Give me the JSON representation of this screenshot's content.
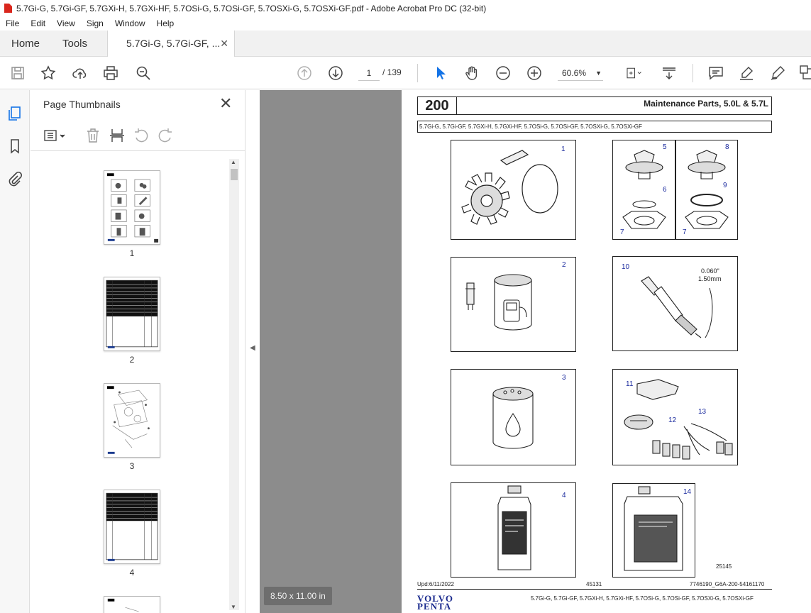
{
  "window": {
    "title": "5.7Gi-G, 5.7Gi-GF, 5.7GXi-H, 5.7GXi-HF, 5.7OSi-G, 5.7OSi-GF, 5.7OSXi-G, 5.7OSXi-GF.pdf - Adobe Acrobat Pro DC (32-bit)"
  },
  "menu": [
    "File",
    "Edit",
    "View",
    "Sign",
    "Window",
    "Help"
  ],
  "tabs": {
    "home": "Home",
    "tools": "Tools",
    "doc": "5.7Gi-G, 5.7Gi-GF, ..."
  },
  "toolbar": {
    "page_current": "1",
    "page_total": "/ 139",
    "zoom": "60.6%"
  },
  "panel": {
    "title": "Page Thumbnails",
    "thumb_labels": [
      "1",
      "2",
      "3",
      "4"
    ]
  },
  "viewer": {
    "page_size": "8.50 x 11.00 in"
  },
  "document": {
    "section_number": "200",
    "heading": "Maintenance Parts, 5.0L & 5.7L",
    "models": "5.7Gi-G, 5.7Gi-GF, 5.7GXi-H, 5.7GXi-HF, 5.7OSi-G, 5.7OSi-GF, 5.7OSXi-G, 5.7OSXi-GF",
    "callouts": [
      "1",
      "5",
      "6",
      "7",
      "8",
      "9",
      "7",
      "2",
      "10",
      "3",
      "11",
      "12",
      "13",
      "4",
      "14"
    ],
    "spark_gap_in": "0.060\"",
    "spark_gap_mm": "1.50mm",
    "figure_ref": "25145",
    "footer_updated": "Upd:6/11/2022",
    "footer_page": "45131",
    "footer_ref": "7746190_G6A-200-54161170",
    "footer_models": "5.7Gi-G, 5.7Gi-GF, 5.7GXi-H, 5.7GXi-HF, 5.7OSi-G, 5.7OSi-GF, 5.7OSXi-G, 5.7OSXi-GF",
    "logo_line1": "VOLVO",
    "logo_line2": "PENTA"
  }
}
